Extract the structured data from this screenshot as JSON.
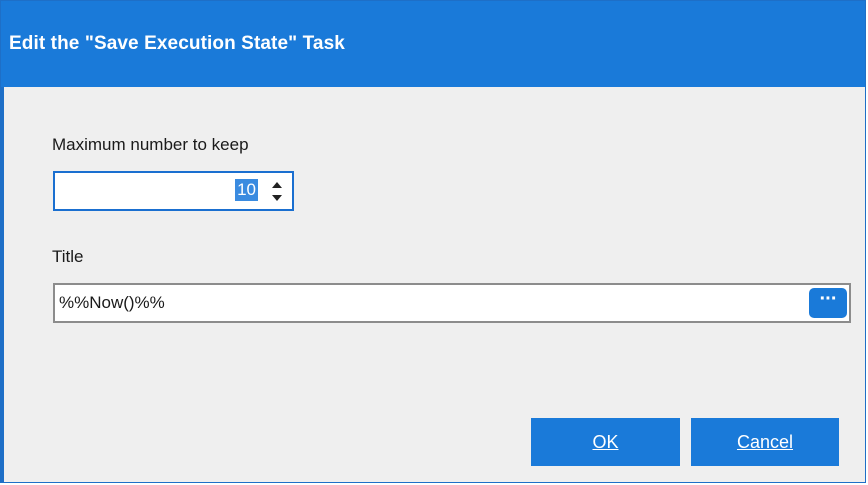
{
  "window": {
    "title": "Edit the \"Save Execution State\" Task"
  },
  "form": {
    "max_keep": {
      "label": "Maximum number to keep",
      "value": "10"
    },
    "title": {
      "label": "Title",
      "value": "%%Now()%%",
      "ellipsis_label": "···"
    }
  },
  "buttons": {
    "ok_label": "OK",
    "cancel_label": "Cancel"
  },
  "colors": {
    "accent": "#1a7ad9",
    "background": "#efefef"
  }
}
